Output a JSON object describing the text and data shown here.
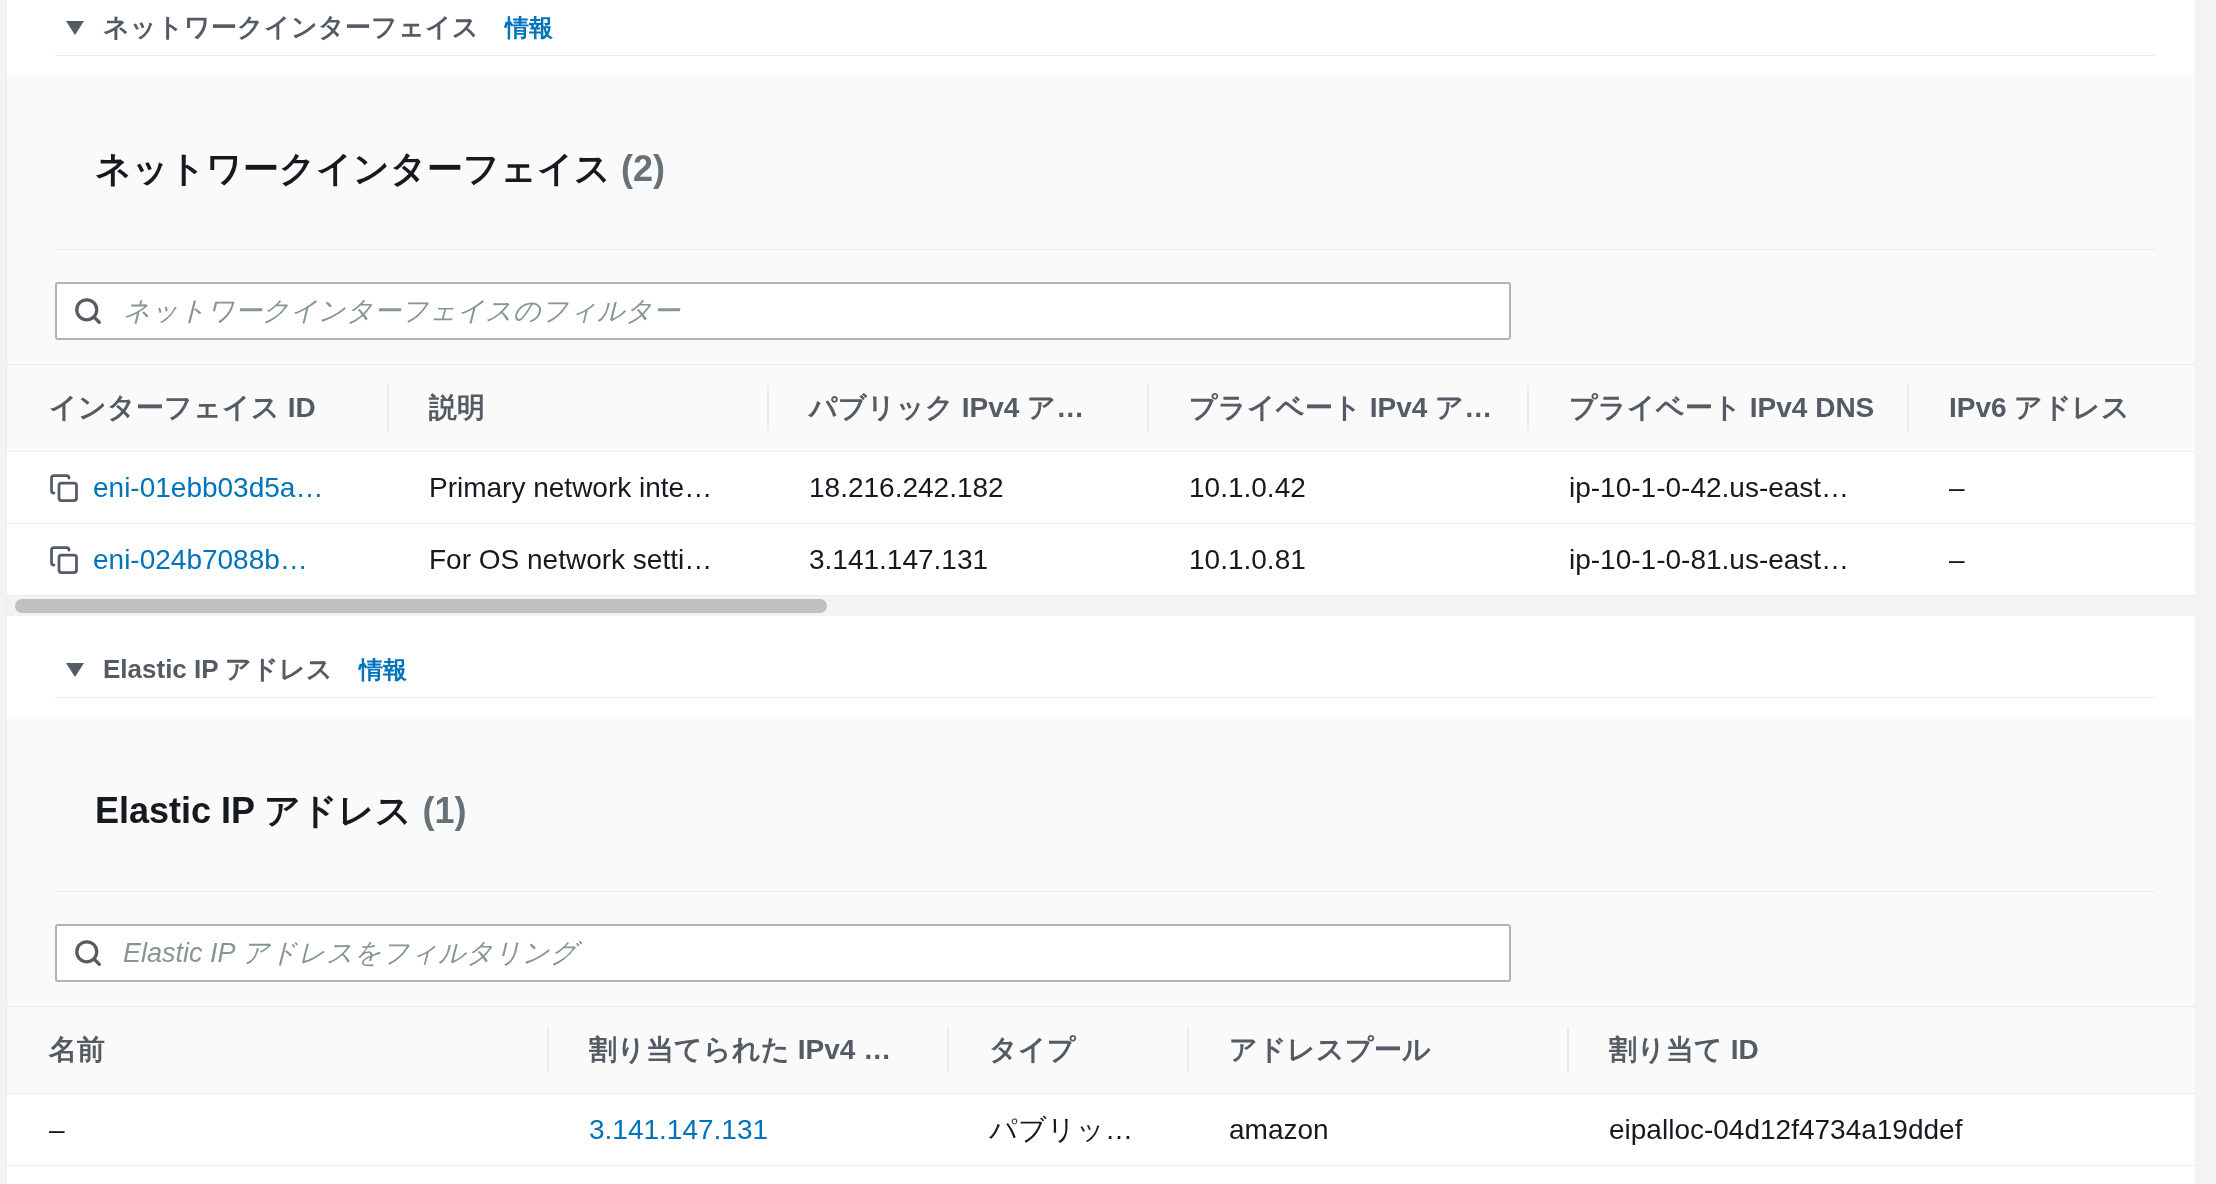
{
  "sections": [
    {
      "header": "ネットワークインターフェイス",
      "info_link": "情報",
      "expanded": true,
      "title": "ネットワークインターフェイス",
      "count": "(2)",
      "filter": {
        "placeholder": "ネットワークインターフェイスのフィルター"
      },
      "scrollable": true,
      "columns": [
        "インターフェイス ID",
        "説明",
        "パブリック IPv4 ア…",
        "プライベート IPv4 ア…",
        "プライベート IPv4 DNS",
        "IPv6 アドレス"
      ],
      "rows": [
        [
          {
            "kind": "copy-link",
            "text": "eni-01ebb03d5a…"
          },
          {
            "kind": "text",
            "text": "Primary network inte…"
          },
          {
            "kind": "text",
            "text": "18.216.242.182"
          },
          {
            "kind": "text",
            "text": "10.1.0.42"
          },
          {
            "kind": "text",
            "text": "ip-10-1-0-42.us-east…"
          },
          {
            "kind": "text",
            "text": "–"
          }
        ],
        [
          {
            "kind": "copy-link",
            "text": "eni-024b7088b…"
          },
          {
            "kind": "text",
            "text": "For OS network setti…"
          },
          {
            "kind": "text",
            "text": "3.141.147.131"
          },
          {
            "kind": "text",
            "text": "10.1.0.81"
          },
          {
            "kind": "text",
            "text": "ip-10-1-0-81.us-east…"
          },
          {
            "kind": "text",
            "text": "–"
          }
        ]
      ]
    },
    {
      "header": "Elastic IP アドレス",
      "info_link": "情報",
      "expanded": true,
      "title": "Elastic IP アドレス",
      "count": "(1)",
      "filter": {
        "placeholder": "Elastic IP アドレスをフィルタリング"
      },
      "scrollable": false,
      "columns": [
        "名前",
        "割り当てられた IPv4 …",
        "タイプ",
        "アドレスプール",
        "割り当て ID"
      ],
      "rows": [
        [
          {
            "kind": "text",
            "text": "–"
          },
          {
            "kind": "link",
            "text": "3.141.147.131"
          },
          {
            "kind": "text",
            "text": "パブリッ…"
          },
          {
            "kind": "text",
            "text": "amazon"
          },
          {
            "kind": "text",
            "text": "eipalloc-04d12f4734a19ddef"
          }
        ]
      ]
    }
  ]
}
